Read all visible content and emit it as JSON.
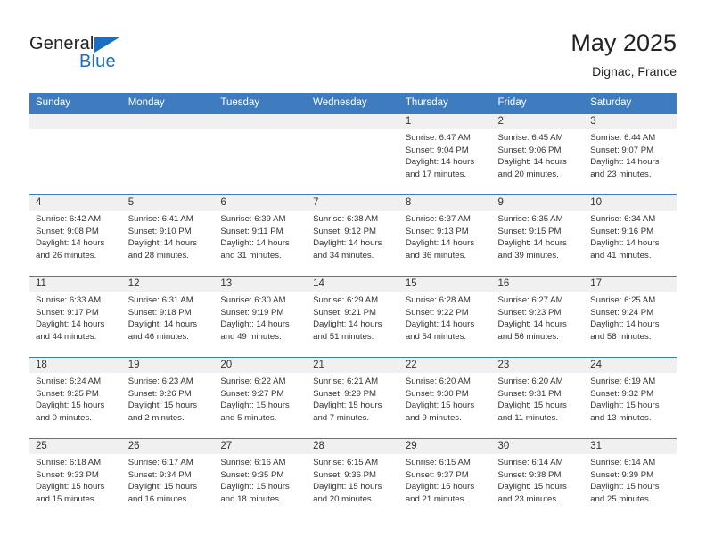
{
  "brand": {
    "name_part1": "General",
    "name_part2": "Blue",
    "triangle_icon": "triangle-icon",
    "accent_color": "#1b6ec2"
  },
  "header": {
    "month_title": "May 2025",
    "location": "Dignac, France"
  },
  "theme": {
    "header_row_bg": "#3e7cbf",
    "daynum_band_bg": "#f0f0f0",
    "text_color": "#333333",
    "grid_line": "#3e7cbf"
  },
  "calendar": {
    "weekday_headers": [
      "Sunday",
      "Monday",
      "Tuesday",
      "Wednesday",
      "Thursday",
      "Friday",
      "Saturday"
    ],
    "weeks": [
      [
        {
          "empty": true
        },
        {
          "empty": true
        },
        {
          "empty": true
        },
        {
          "empty": true
        },
        {
          "day": "1",
          "sunrise": "Sunrise: 6:47 AM",
          "sunset": "Sunset: 9:04 PM",
          "daylight_line1": "Daylight: 14 hours",
          "daylight_line2": "and 17 minutes."
        },
        {
          "day": "2",
          "sunrise": "Sunrise: 6:45 AM",
          "sunset": "Sunset: 9:06 PM",
          "daylight_line1": "Daylight: 14 hours",
          "daylight_line2": "and 20 minutes."
        },
        {
          "day": "3",
          "sunrise": "Sunrise: 6:44 AM",
          "sunset": "Sunset: 9:07 PM",
          "daylight_line1": "Daylight: 14 hours",
          "daylight_line2": "and 23 minutes."
        }
      ],
      [
        {
          "day": "4",
          "sunrise": "Sunrise: 6:42 AM",
          "sunset": "Sunset: 9:08 PM",
          "daylight_line1": "Daylight: 14 hours",
          "daylight_line2": "and 26 minutes."
        },
        {
          "day": "5",
          "sunrise": "Sunrise: 6:41 AM",
          "sunset": "Sunset: 9:10 PM",
          "daylight_line1": "Daylight: 14 hours",
          "daylight_line2": "and 28 minutes."
        },
        {
          "day": "6",
          "sunrise": "Sunrise: 6:39 AM",
          "sunset": "Sunset: 9:11 PM",
          "daylight_line1": "Daylight: 14 hours",
          "daylight_line2": "and 31 minutes."
        },
        {
          "day": "7",
          "sunrise": "Sunrise: 6:38 AM",
          "sunset": "Sunset: 9:12 PM",
          "daylight_line1": "Daylight: 14 hours",
          "daylight_line2": "and 34 minutes."
        },
        {
          "day": "8",
          "sunrise": "Sunrise: 6:37 AM",
          "sunset": "Sunset: 9:13 PM",
          "daylight_line1": "Daylight: 14 hours",
          "daylight_line2": "and 36 minutes."
        },
        {
          "day": "9",
          "sunrise": "Sunrise: 6:35 AM",
          "sunset": "Sunset: 9:15 PM",
          "daylight_line1": "Daylight: 14 hours",
          "daylight_line2": "and 39 minutes."
        },
        {
          "day": "10",
          "sunrise": "Sunrise: 6:34 AM",
          "sunset": "Sunset: 9:16 PM",
          "daylight_line1": "Daylight: 14 hours",
          "daylight_line2": "and 41 minutes."
        }
      ],
      [
        {
          "day": "11",
          "sunrise": "Sunrise: 6:33 AM",
          "sunset": "Sunset: 9:17 PM",
          "daylight_line1": "Daylight: 14 hours",
          "daylight_line2": "and 44 minutes."
        },
        {
          "day": "12",
          "sunrise": "Sunrise: 6:31 AM",
          "sunset": "Sunset: 9:18 PM",
          "daylight_line1": "Daylight: 14 hours",
          "daylight_line2": "and 46 minutes."
        },
        {
          "day": "13",
          "sunrise": "Sunrise: 6:30 AM",
          "sunset": "Sunset: 9:19 PM",
          "daylight_line1": "Daylight: 14 hours",
          "daylight_line2": "and 49 minutes."
        },
        {
          "day": "14",
          "sunrise": "Sunrise: 6:29 AM",
          "sunset": "Sunset: 9:21 PM",
          "daylight_line1": "Daylight: 14 hours",
          "daylight_line2": "and 51 minutes."
        },
        {
          "day": "15",
          "sunrise": "Sunrise: 6:28 AM",
          "sunset": "Sunset: 9:22 PM",
          "daylight_line1": "Daylight: 14 hours",
          "daylight_line2": "and 54 minutes."
        },
        {
          "day": "16",
          "sunrise": "Sunrise: 6:27 AM",
          "sunset": "Sunset: 9:23 PM",
          "daylight_line1": "Daylight: 14 hours",
          "daylight_line2": "and 56 minutes."
        },
        {
          "day": "17",
          "sunrise": "Sunrise: 6:25 AM",
          "sunset": "Sunset: 9:24 PM",
          "daylight_line1": "Daylight: 14 hours",
          "daylight_line2": "and 58 minutes."
        }
      ],
      [
        {
          "day": "18",
          "sunrise": "Sunrise: 6:24 AM",
          "sunset": "Sunset: 9:25 PM",
          "daylight_line1": "Daylight: 15 hours",
          "daylight_line2": "and 0 minutes."
        },
        {
          "day": "19",
          "sunrise": "Sunrise: 6:23 AM",
          "sunset": "Sunset: 9:26 PM",
          "daylight_line1": "Daylight: 15 hours",
          "daylight_line2": "and 2 minutes."
        },
        {
          "day": "20",
          "sunrise": "Sunrise: 6:22 AM",
          "sunset": "Sunset: 9:27 PM",
          "daylight_line1": "Daylight: 15 hours",
          "daylight_line2": "and 5 minutes."
        },
        {
          "day": "21",
          "sunrise": "Sunrise: 6:21 AM",
          "sunset": "Sunset: 9:29 PM",
          "daylight_line1": "Daylight: 15 hours",
          "daylight_line2": "and 7 minutes."
        },
        {
          "day": "22",
          "sunrise": "Sunrise: 6:20 AM",
          "sunset": "Sunset: 9:30 PM",
          "daylight_line1": "Daylight: 15 hours",
          "daylight_line2": "and 9 minutes."
        },
        {
          "day": "23",
          "sunrise": "Sunrise: 6:20 AM",
          "sunset": "Sunset: 9:31 PM",
          "daylight_line1": "Daylight: 15 hours",
          "daylight_line2": "and 11 minutes."
        },
        {
          "day": "24",
          "sunrise": "Sunrise: 6:19 AM",
          "sunset": "Sunset: 9:32 PM",
          "daylight_line1": "Daylight: 15 hours",
          "daylight_line2": "and 13 minutes."
        }
      ],
      [
        {
          "day": "25",
          "sunrise": "Sunrise: 6:18 AM",
          "sunset": "Sunset: 9:33 PM",
          "daylight_line1": "Daylight: 15 hours",
          "daylight_line2": "and 15 minutes."
        },
        {
          "day": "26",
          "sunrise": "Sunrise: 6:17 AM",
          "sunset": "Sunset: 9:34 PM",
          "daylight_line1": "Daylight: 15 hours",
          "daylight_line2": "and 16 minutes."
        },
        {
          "day": "27",
          "sunrise": "Sunrise: 6:16 AM",
          "sunset": "Sunset: 9:35 PM",
          "daylight_line1": "Daylight: 15 hours",
          "daylight_line2": "and 18 minutes."
        },
        {
          "day": "28",
          "sunrise": "Sunrise: 6:15 AM",
          "sunset": "Sunset: 9:36 PM",
          "daylight_line1": "Daylight: 15 hours",
          "daylight_line2": "and 20 minutes."
        },
        {
          "day": "29",
          "sunrise": "Sunrise: 6:15 AM",
          "sunset": "Sunset: 9:37 PM",
          "daylight_line1": "Daylight: 15 hours",
          "daylight_line2": "and 21 minutes."
        },
        {
          "day": "30",
          "sunrise": "Sunrise: 6:14 AM",
          "sunset": "Sunset: 9:38 PM",
          "daylight_line1": "Daylight: 15 hours",
          "daylight_line2": "and 23 minutes."
        },
        {
          "day": "31",
          "sunrise": "Sunrise: 6:14 AM",
          "sunset": "Sunset: 9:39 PM",
          "daylight_line1": "Daylight: 15 hours",
          "daylight_line2": "and 25 minutes."
        }
      ]
    ]
  }
}
